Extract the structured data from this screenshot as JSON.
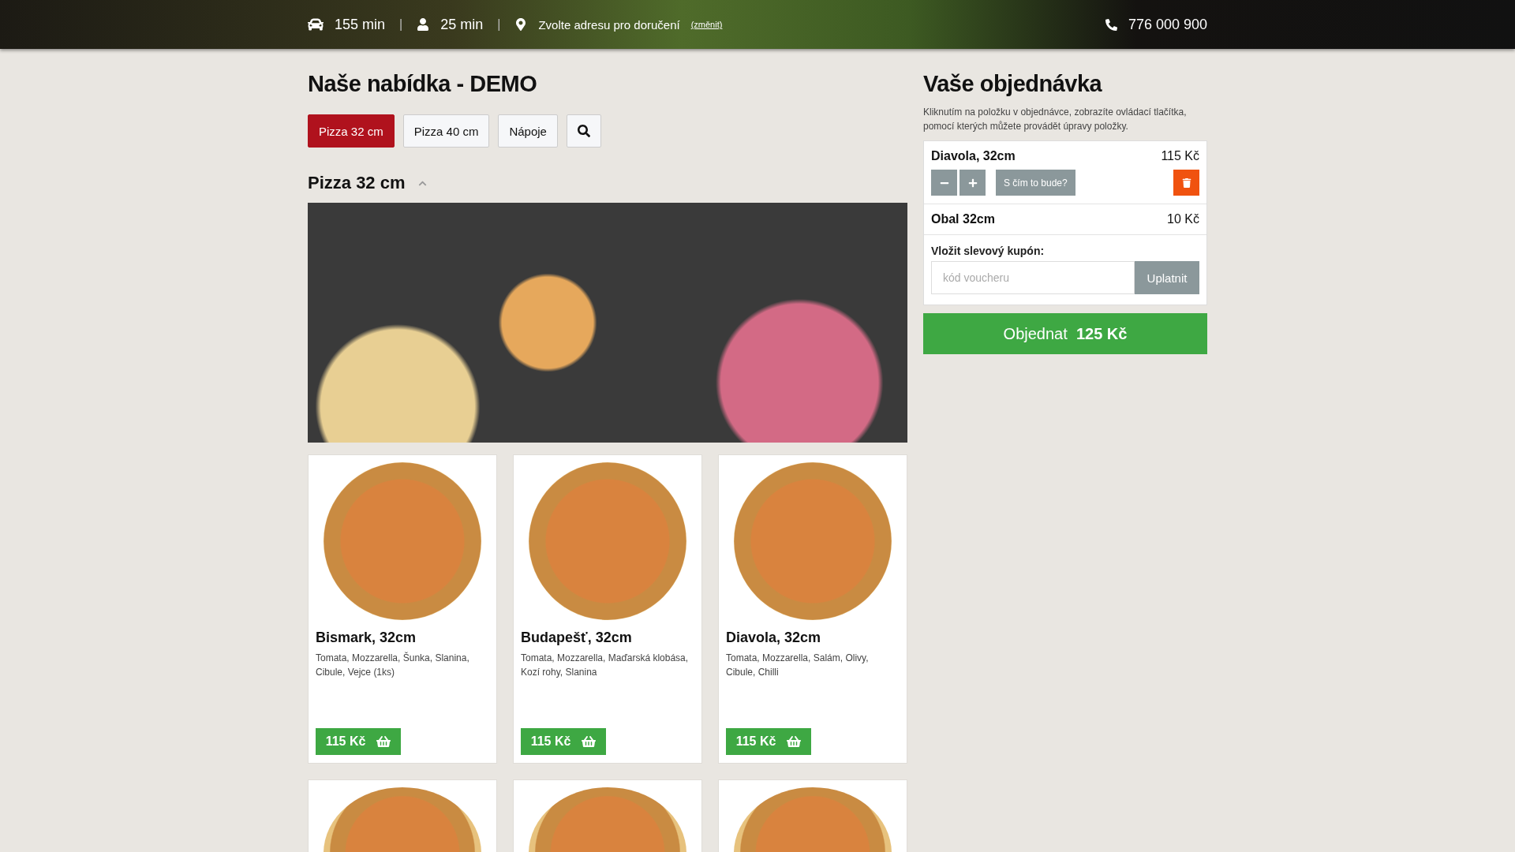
{
  "top_bar": {
    "delivery_time": "155 min",
    "pickup_time": "25 min",
    "separator": "|",
    "address": "Zvolte adresu pro doručení",
    "change_link": "(změnit)",
    "phone": "776 000 900"
  },
  "menu": {
    "title": "Naše nabídka - DEMO",
    "tabs": [
      {
        "kind": "text",
        "label": "Pizza 32 cm",
        "selected": true
      },
      {
        "kind": "text",
        "label": "Pizza 40 cm",
        "selected": false
      },
      {
        "kind": "text",
        "label": "Nápoje",
        "selected": false
      },
      {
        "kind": "search",
        "selected": false
      }
    ],
    "section": {
      "title": "Pizza 32 cm",
      "expanded": true
    },
    "products": [
      {
        "kind": "full",
        "name": "Bismark, 32cm",
        "ingredients": "Tomata, Mozzarella, Šunka, Slanina, Cibule, Vejce (1ks)",
        "price": "115 Kč"
      },
      {
        "kind": "full",
        "name": "Budapešť, 32cm",
        "ingredients": "Tomata, Mozzarella, Maďarská klobása, Kozí rohy, Slanina",
        "price": "115 Kč"
      },
      {
        "kind": "full",
        "name": "Diavola, 32cm",
        "ingredients": "Tomata, Mozzarella, Salám, Olivy, Cibule, Chilli",
        "price": "115 Kč"
      },
      {
        "kind": "cut_off"
      },
      {
        "kind": "cut_off"
      },
      {
        "kind": "cut_off"
      }
    ]
  },
  "order": {
    "title": "Vaše objednávka",
    "hint": "Kliknutím na položku v objednávce, zobrazíte ovládací tlačítka, pomocí kterých můžete provádět úpravy položky.",
    "items": [
      {
        "name": "Diavola, 32cm",
        "price": "115 Kč",
        "expanded": true,
        "extras_button": "S čím to bude?"
      },
      {
        "name": "Obal 32cm",
        "price": "10 Kč",
        "expanded": false
      }
    ],
    "coupon_label": "Vložit slevový kupón:",
    "coupon_placeholder": "kód voucheru",
    "coupon_button": "Uplatnit",
    "submit_label": "Objednat",
    "submit_total": "125 Kč"
  }
}
